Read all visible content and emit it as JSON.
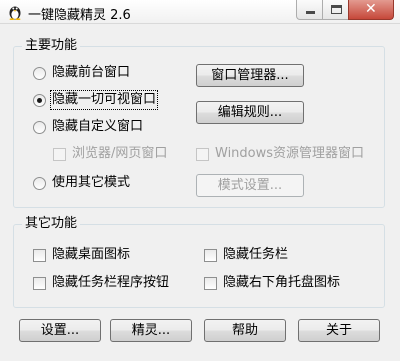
{
  "window": {
    "title": "一键隐藏精灵 2.6",
    "close_glyph": "✕"
  },
  "main_group": {
    "title": "主要功能",
    "radios": {
      "hide_foreground": "隐藏前台窗口",
      "hide_all_visible": "隐藏一切可视窗口",
      "hide_custom": "隐藏自定义窗口",
      "other_mode": "使用其它模式"
    },
    "selected": "hide_all_visible",
    "checks": {
      "browser": "浏览器/网页窗口",
      "windows_explorer": "Windows资源管理器窗口"
    },
    "buttons": {
      "window_manager": "窗口管理器...",
      "edit_rules": "编辑规则...",
      "mode_settings": "模式设置..."
    }
  },
  "other_group": {
    "title": "其它功能",
    "checks": {
      "hide_desktop_icons": "隐藏桌面图标",
      "hide_taskbar": "隐藏任务栏",
      "hide_taskbar_buttons": "隐藏任务栏程序按钮",
      "hide_tray_icons": "隐藏右下角托盘图标"
    }
  },
  "footer_buttons": {
    "settings": "设置...",
    "wizard": "精灵...",
    "help": "帮助",
    "about": "关于"
  }
}
